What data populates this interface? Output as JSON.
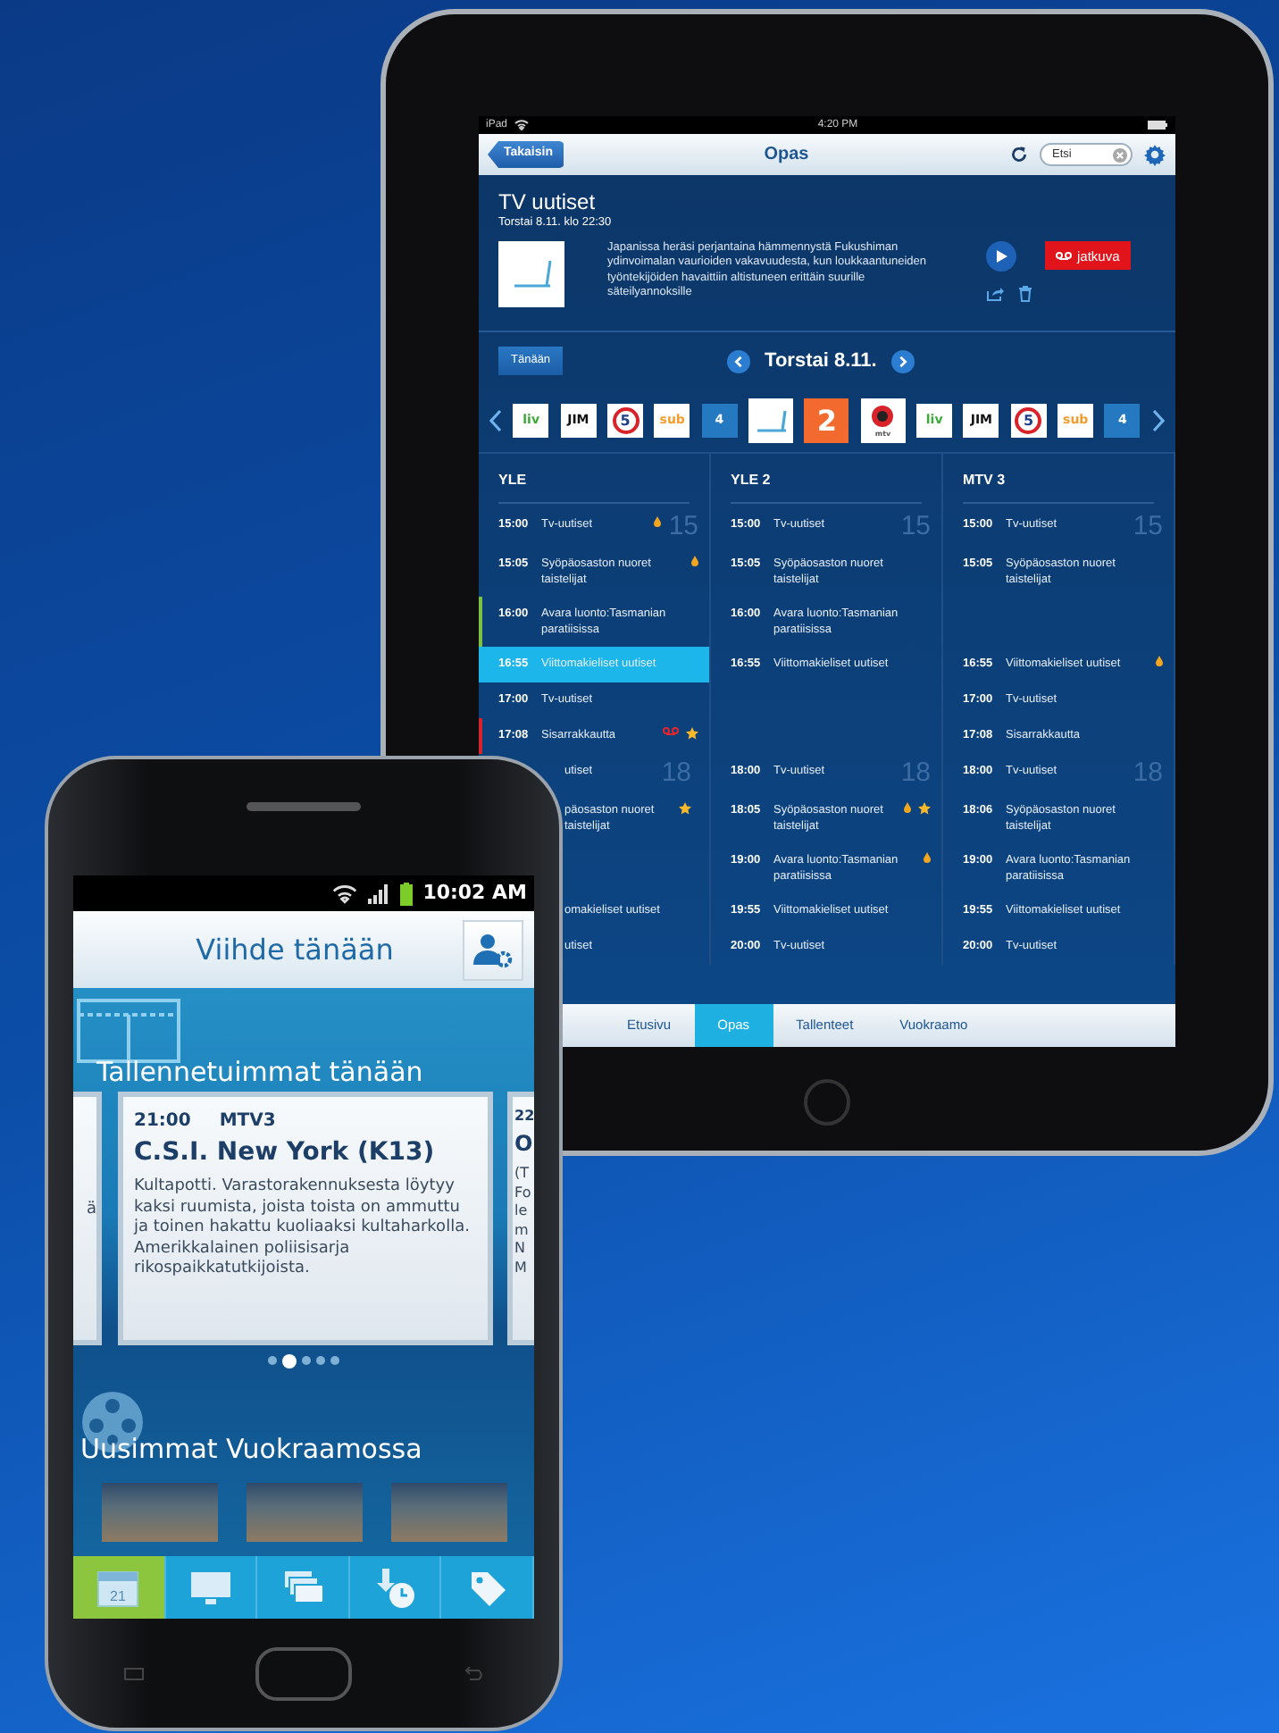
{
  "tablet": {
    "status_bar": {
      "device": "iPad",
      "time": "4:20 PM"
    },
    "nav_bar": {
      "back": "Takaisin",
      "title": "Opas",
      "search": {
        "placeholder": "Etsi"
      }
    },
    "program": {
      "title": "TV uutiset",
      "datetime": "Torstai 8.11. klo 22:30",
      "description": "Japanissa heräsi perjantaina hämmennystä Fukushiman ydinvoimalan vaurioiden vakavuudesta, kun loukkaantuneiden työntekijöiden havaittiin altistuneen erittäin suurille säteilyannoksille",
      "record_button": "jatkuva"
    },
    "date_bar": {
      "today_button": "Tänään",
      "date": "Torstai 8.11."
    },
    "channels": [
      {
        "kind": "text",
        "label": "liv",
        "color": "#3aa935",
        "selected": false
      },
      {
        "kind": "text",
        "label": "JIM",
        "color": "#111111",
        "selected": false
      },
      {
        "kind": "ring",
        "label": "5",
        "color": "#d8232a",
        "selected": false
      },
      {
        "kind": "text",
        "label": "sub",
        "color": "#f39c2c",
        "selected": false
      },
      {
        "kind": "tile",
        "label": "4",
        "color": "#2479c0",
        "selected": false
      },
      {
        "kind": "yle",
        "color": "#4aa8d8",
        "selected": true
      },
      {
        "kind": "tile",
        "label": "2",
        "color": "#f26a2e",
        "selected": true
      },
      {
        "kind": "mtv",
        "label": "mtv",
        "color": "#d8232a",
        "selected": true
      },
      {
        "kind": "text",
        "label": "liv",
        "color": "#3aa935",
        "selected": false
      },
      {
        "kind": "text",
        "label": "JIM",
        "color": "#111111",
        "selected": false
      },
      {
        "kind": "ring",
        "label": "5",
        "color": "#d8232a",
        "selected": false
      },
      {
        "kind": "text",
        "label": "sub",
        "color": "#f39c2c",
        "selected": false
      },
      {
        "kind": "tile",
        "label": "4",
        "color": "#2479c0",
        "selected": false
      }
    ],
    "guide": {
      "columns": [
        {
          "name": "YLE"
        },
        {
          "name": "YLE 2"
        },
        {
          "name": "MTV 3"
        }
      ],
      "slots": [
        {
          "cells": [
            {
              "kind": "program",
              "time": "15:00",
              "title": "Tv-uutiset",
              "hour": "15",
              "selected": false,
              "flagged": true,
              "favorite": false,
              "recording": false
            },
            {
              "kind": "program",
              "time": "15:00",
              "title": "Tv-uutiset",
              "hour": "15",
              "selected": false,
              "flagged": false,
              "favorite": false,
              "recording": false
            },
            {
              "kind": "program",
              "time": "15:00",
              "title": "Tv-uutiset",
              "hour": "15",
              "selected": false,
              "flagged": false,
              "favorite": false,
              "recording": false
            }
          ]
        },
        {
          "cells": [
            {
              "kind": "program",
              "time": "15:05",
              "title": "Syöpäosaston nuoret taistelijat",
              "selected": false,
              "flagged": true,
              "favorite": false,
              "recording": false
            },
            {
              "kind": "program",
              "time": "15:05",
              "title": "Syöpäosaston nuoret taistelijat",
              "selected": false,
              "flagged": false,
              "favorite": false,
              "recording": false
            },
            {
              "kind": "program",
              "time": "15:05",
              "title": "Syöpäosaston nuoret taistelijat",
              "selected": false,
              "flagged": false,
              "favorite": false,
              "recording": false
            }
          ]
        },
        {
          "cells": [
            {
              "kind": "program",
              "time": "16:00",
              "title": "Avara luonto:Tasmanian paratiisissa",
              "color": "#7cc142",
              "selected": false,
              "flagged": false,
              "favorite": false,
              "recording": false
            },
            {
              "kind": "program",
              "time": "16:00",
              "title": "Avara luonto:Tasmanian paratiisissa",
              "selected": false,
              "flagged": false,
              "favorite": false,
              "recording": false
            },
            null
          ]
        },
        {
          "cells": [
            {
              "kind": "program",
              "time": "16:55",
              "title": "Viittomakieliset uutiset",
              "selected": true,
              "flagged": false,
              "favorite": false,
              "recording": false
            },
            {
              "kind": "program",
              "time": "16:55",
              "title": "Viittomakieliset uutiset",
              "selected": false,
              "flagged": false,
              "favorite": false,
              "recording": false
            },
            {
              "kind": "program",
              "time": "16:55",
              "title": "Viittomakieliset uutiset",
              "selected": false,
              "flagged": true,
              "favorite": false,
              "recording": false
            }
          ]
        },
        {
          "cells": [
            {
              "kind": "program",
              "time": "17:00",
              "title": "Tv-uutiset",
              "selected": false,
              "flagged": false,
              "favorite": false,
              "recording": false
            },
            null,
            {
              "kind": "program",
              "time": "17:00",
              "title": "Tv-uutiset",
              "selected": false,
              "flagged": false,
              "favorite": false,
              "recording": false
            }
          ]
        },
        {
          "cells": [
            {
              "kind": "program",
              "time": "17:08",
              "title": "Sisarrakkautta",
              "color": "#d8232a",
              "selected": false,
              "flagged": false,
              "favorite": true,
              "recording": true
            },
            null,
            {
              "kind": "program",
              "time": "17:08",
              "title": "Sisarrakkautta",
              "selected": false,
              "flagged": false,
              "favorite": false,
              "recording": false
            }
          ]
        },
        {
          "cells": [
            {
              "kind": "partial",
              "title": "utiset",
              "hour": "18",
              "selected": false,
              "flagged": false,
              "favorite": false,
              "recording": false
            },
            {
              "kind": "program",
              "time": "18:00",
              "title": "Tv-uutiset",
              "hour": "18",
              "selected": false,
              "flagged": false,
              "favorite": false,
              "recording": false
            },
            {
              "kind": "program",
              "time": "18:00",
              "title": "Tv-uutiset",
              "hour": "18",
              "selected": false,
              "flagged": false,
              "favorite": false,
              "recording": false
            }
          ]
        },
        {
          "cells": [
            {
              "kind": "partial",
              "title": "päosaston nuoret taistelijat",
              "selected": false,
              "flagged": false,
              "favorite": true,
              "recording": false
            },
            {
              "kind": "program",
              "time": "18:05",
              "title": "Syöpäosaston nuoret taistelijat",
              "selected": false,
              "flagged": true,
              "favorite": true,
              "recording": false
            },
            {
              "kind": "program",
              "time": "18:06",
              "title": "Syöpäosaston nuoret taistelijat",
              "selected": false,
              "flagged": false,
              "favorite": false,
              "recording": false
            }
          ]
        },
        {
          "cells": [
            null,
            {
              "kind": "program",
              "time": "19:00",
              "title": "Avara luonto:Tasmanian paratiisissa",
              "selected": false,
              "flagged": true,
              "favorite": false,
              "recording": false
            },
            {
              "kind": "program",
              "time": "19:00",
              "title": "Avara luonto:Tasmanian paratiisissa",
              "selected": false,
              "flagged": false,
              "favorite": false,
              "recording": false
            }
          ]
        },
        {
          "cells": [
            {
              "kind": "partial",
              "title": "omakieliset uutiset",
              "selected": false,
              "flagged": false,
              "favorite": false,
              "recording": false
            },
            {
              "kind": "program",
              "time": "19:55",
              "title": "Viittomakieliset uutiset",
              "selected": false,
              "flagged": false,
              "favorite": false,
              "recording": false
            },
            {
              "kind": "program",
              "time": "19:55",
              "title": "Viittomakieliset uutiset",
              "selected": false,
              "flagged": false,
              "favorite": false,
              "recording": false
            }
          ]
        },
        {
          "cells": [
            {
              "kind": "partial",
              "title": "utiset",
              "selected": false,
              "flagged": false,
              "favorite": false,
              "recording": false
            },
            {
              "kind": "program",
              "time": "20:00",
              "title": "Tv-uutiset",
              "selected": false,
              "flagged": false,
              "favorite": false,
              "recording": false
            },
            {
              "kind": "program",
              "time": "20:00",
              "title": "Tv-uutiset",
              "selected": false,
              "flagged": false,
              "favorite": false,
              "recording": false
            }
          ]
        }
      ]
    },
    "tabs": [
      {
        "label": "Etusivu",
        "selected": false
      },
      {
        "label": "Opas",
        "selected": true
      },
      {
        "label": "Tallenteet",
        "selected": false
      },
      {
        "label": "Vuokraamo",
        "selected": false
      }
    ]
  },
  "phone": {
    "status_bar": {
      "time": "10:02 AM"
    },
    "header": {
      "title": "Viihde tänään"
    },
    "recordings": {
      "title": "Tallennetuimmat tänään",
      "cards": [
        {
          "kind": "partial-left",
          "lines": [
            "ä"
          ]
        },
        {
          "kind": "full",
          "time": "21:00",
          "channel": "MTV3",
          "title": "C.S.I. New York (K13)",
          "description": "Kultapotti. Varastorakennuksesta löytyy kaksi ruumista, joista toista on ammuttu ja toinen hakattu kuoliaaksi kultaharkolla. Amerikkalainen poliisisarja rikospaikkatutkijoista."
        },
        {
          "kind": "partial-right",
          "time": "22",
          "title": "O",
          "lines": [
            "(T",
            "Fo",
            "le",
            "m",
            "N",
            "M"
          ]
        }
      ],
      "pages": [
        {
          "selected": false
        },
        {
          "selected": true
        },
        {
          "selected": false
        },
        {
          "selected": false
        },
        {
          "selected": false
        }
      ]
    },
    "rentals": {
      "title": "Uusimmat Vuokraamossa",
      "posters": [
        {
          "kind": "photo"
        },
        {
          "kind": "photo"
        },
        {
          "kind": "photo"
        }
      ]
    },
    "nav": [
      {
        "kind": "calendar",
        "label": "21",
        "selected": true
      },
      {
        "kind": "monitor",
        "selected": false
      },
      {
        "kind": "frames",
        "selected": false
      },
      {
        "kind": "clock",
        "selected": false
      },
      {
        "kind": "tag",
        "selected": false
      }
    ]
  }
}
